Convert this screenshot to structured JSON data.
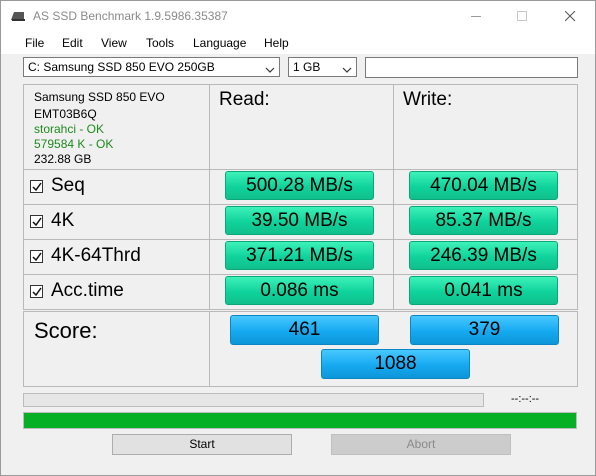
{
  "window": {
    "title": "AS SSD Benchmark 1.9.5986.35387"
  },
  "menu": [
    "File",
    "Edit",
    "View",
    "Tools",
    "Language",
    "Help"
  ],
  "toolbar": {
    "drive_selected": "C: Samsung SSD 850 EVO 250GB",
    "size_selected": "1 GB",
    "text_value": ""
  },
  "drive_info": {
    "model": "Samsung SSD 850 EVO",
    "firmware": "EMT03B6Q",
    "driver": "storahci - OK",
    "alignment": "579584 K - OK",
    "capacity": "232.88 GB"
  },
  "columns": {
    "read": "Read:",
    "write": "Write:"
  },
  "tests": [
    {
      "name": "Seq",
      "checked": true,
      "read": "500.28 MB/s",
      "write": "470.04 MB/s"
    },
    {
      "name": "4K",
      "checked": true,
      "read": "39.50 MB/s",
      "write": "85.37 MB/s"
    },
    {
      "name": "4K-64Thrd",
      "checked": true,
      "read": "371.21 MB/s",
      "write": "246.39 MB/s"
    },
    {
      "name": "Acc.time",
      "checked": true,
      "read": "0.086 ms",
      "write": "0.041 ms"
    }
  ],
  "score": {
    "label": "Score:",
    "read": "461",
    "write": "379",
    "total": "1088"
  },
  "progress": {
    "time": "--:--:--",
    "overall_fraction": 1.0
  },
  "buttons": {
    "start": "Start",
    "abort": "Abort"
  },
  "colors": {
    "result_green": "#0fd39c",
    "score_blue": "#15a9f0",
    "progress_green": "#06b025",
    "ok_text": "#1e8a1e"
  }
}
